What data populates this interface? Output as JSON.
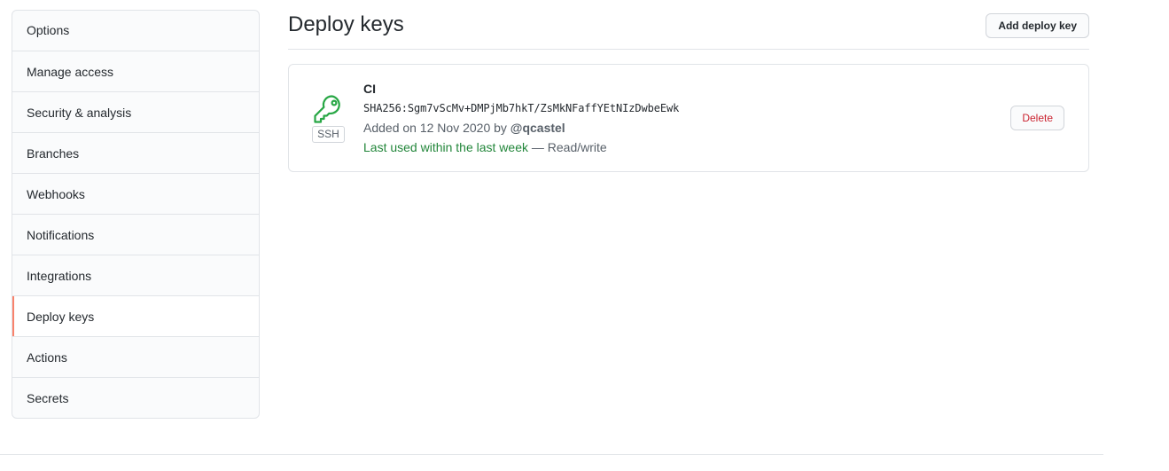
{
  "sidebar": {
    "items": [
      {
        "label": "Options"
      },
      {
        "label": "Manage access"
      },
      {
        "label": "Security & analysis"
      },
      {
        "label": "Branches"
      },
      {
        "label": "Webhooks"
      },
      {
        "label": "Notifications"
      },
      {
        "label": "Integrations"
      },
      {
        "label": "Deploy keys"
      },
      {
        "label": "Actions"
      },
      {
        "label": "Secrets"
      }
    ],
    "selected": "Deploy keys",
    "accent_color": "#f9826c"
  },
  "header": {
    "title": "Deploy keys",
    "add_button_label": "Add deploy key"
  },
  "key": {
    "icon": "key-icon",
    "icon_color": "#28a745",
    "type_label": "SSH",
    "title": "CI",
    "fingerprint": "SHA256:Sgm7vScMv+DMPjMb7hkT/ZsMkNFaffYEtNIzDwbeEwk",
    "added_prefix": "Added on 12 Nov 2020 by ",
    "added_by": "@qcastel",
    "last_used": "Last used within the last week",
    "access": " — Read/write",
    "delete_label": "Delete",
    "delete_color": "#cb2431"
  }
}
